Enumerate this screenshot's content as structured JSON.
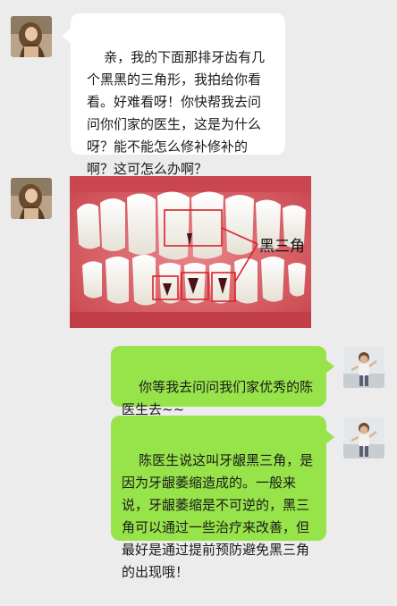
{
  "chat": {
    "messages": [
      {
        "side": "left",
        "text": "亲，我的下面那排牙齿有几个黑黑的三角形，我拍给你看看。好难看呀！你快帮我去问问你们家的医生，这是为什么呀？能不能怎么修补修补的啊？这可怎么办啊？"
      },
      {
        "side": "left",
        "image_label": "黑三角"
      },
      {
        "side": "right",
        "text": "你等我去问问我们家优秀的陈医生去~~"
      },
      {
        "side": "right",
        "text": "陈医生说这叫牙龈黑三角，是因为牙龈萎缩造成的。一般来说，牙龈萎缩是不可逆的，黑三角可以通过一些治疗来改善，但最好是通过提前预防避免黑三角的出现哦！"
      }
    ]
  },
  "colors": {
    "background": "#ececec",
    "incoming_bubble": "#ffffff",
    "outgoing_bubble": "#97e34a",
    "annotation": "#d8232a"
  }
}
